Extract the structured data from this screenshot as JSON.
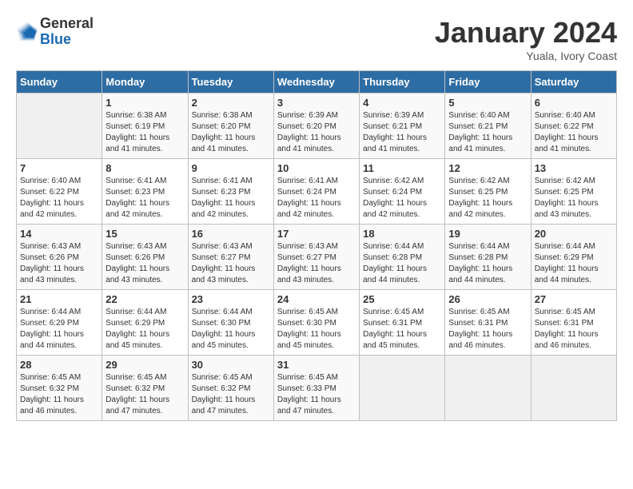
{
  "header": {
    "logo": {
      "general": "General",
      "blue": "Blue"
    },
    "title": "January 2024",
    "subtitle": "Yuala, Ivory Coast"
  },
  "weekdays": [
    "Sunday",
    "Monday",
    "Tuesday",
    "Wednesday",
    "Thursday",
    "Friday",
    "Saturday"
  ],
  "weeks": [
    [
      {
        "day": "",
        "sunrise": "",
        "sunset": "",
        "daylight": ""
      },
      {
        "day": "1",
        "sunrise": "Sunrise: 6:38 AM",
        "sunset": "Sunset: 6:19 PM",
        "daylight": "Daylight: 11 hours and 41 minutes."
      },
      {
        "day": "2",
        "sunrise": "Sunrise: 6:38 AM",
        "sunset": "Sunset: 6:20 PM",
        "daylight": "Daylight: 11 hours and 41 minutes."
      },
      {
        "day": "3",
        "sunrise": "Sunrise: 6:39 AM",
        "sunset": "Sunset: 6:20 PM",
        "daylight": "Daylight: 11 hours and 41 minutes."
      },
      {
        "day": "4",
        "sunrise": "Sunrise: 6:39 AM",
        "sunset": "Sunset: 6:21 PM",
        "daylight": "Daylight: 11 hours and 41 minutes."
      },
      {
        "day": "5",
        "sunrise": "Sunrise: 6:40 AM",
        "sunset": "Sunset: 6:21 PM",
        "daylight": "Daylight: 11 hours and 41 minutes."
      },
      {
        "day": "6",
        "sunrise": "Sunrise: 6:40 AM",
        "sunset": "Sunset: 6:22 PM",
        "daylight": "Daylight: 11 hours and 41 minutes."
      }
    ],
    [
      {
        "day": "7",
        "sunrise": "Sunrise: 6:40 AM",
        "sunset": "Sunset: 6:22 PM",
        "daylight": "Daylight: 11 hours and 42 minutes."
      },
      {
        "day": "8",
        "sunrise": "Sunrise: 6:41 AM",
        "sunset": "Sunset: 6:23 PM",
        "daylight": "Daylight: 11 hours and 42 minutes."
      },
      {
        "day": "9",
        "sunrise": "Sunrise: 6:41 AM",
        "sunset": "Sunset: 6:23 PM",
        "daylight": "Daylight: 11 hours and 42 minutes."
      },
      {
        "day": "10",
        "sunrise": "Sunrise: 6:41 AM",
        "sunset": "Sunset: 6:24 PM",
        "daylight": "Daylight: 11 hours and 42 minutes."
      },
      {
        "day": "11",
        "sunrise": "Sunrise: 6:42 AM",
        "sunset": "Sunset: 6:24 PM",
        "daylight": "Daylight: 11 hours and 42 minutes."
      },
      {
        "day": "12",
        "sunrise": "Sunrise: 6:42 AM",
        "sunset": "Sunset: 6:25 PM",
        "daylight": "Daylight: 11 hours and 42 minutes."
      },
      {
        "day": "13",
        "sunrise": "Sunrise: 6:42 AM",
        "sunset": "Sunset: 6:25 PM",
        "daylight": "Daylight: 11 hours and 43 minutes."
      }
    ],
    [
      {
        "day": "14",
        "sunrise": "Sunrise: 6:43 AM",
        "sunset": "Sunset: 6:26 PM",
        "daylight": "Daylight: 11 hours and 43 minutes."
      },
      {
        "day": "15",
        "sunrise": "Sunrise: 6:43 AM",
        "sunset": "Sunset: 6:26 PM",
        "daylight": "Daylight: 11 hours and 43 minutes."
      },
      {
        "day": "16",
        "sunrise": "Sunrise: 6:43 AM",
        "sunset": "Sunset: 6:27 PM",
        "daylight": "Daylight: 11 hours and 43 minutes."
      },
      {
        "day": "17",
        "sunrise": "Sunrise: 6:43 AM",
        "sunset": "Sunset: 6:27 PM",
        "daylight": "Daylight: 11 hours and 43 minutes."
      },
      {
        "day": "18",
        "sunrise": "Sunrise: 6:44 AM",
        "sunset": "Sunset: 6:28 PM",
        "daylight": "Daylight: 11 hours and 44 minutes."
      },
      {
        "day": "19",
        "sunrise": "Sunrise: 6:44 AM",
        "sunset": "Sunset: 6:28 PM",
        "daylight": "Daylight: 11 hours and 44 minutes."
      },
      {
        "day": "20",
        "sunrise": "Sunrise: 6:44 AM",
        "sunset": "Sunset: 6:29 PM",
        "daylight": "Daylight: 11 hours and 44 minutes."
      }
    ],
    [
      {
        "day": "21",
        "sunrise": "Sunrise: 6:44 AM",
        "sunset": "Sunset: 6:29 PM",
        "daylight": "Daylight: 11 hours and 44 minutes."
      },
      {
        "day": "22",
        "sunrise": "Sunrise: 6:44 AM",
        "sunset": "Sunset: 6:29 PM",
        "daylight": "Daylight: 11 hours and 45 minutes."
      },
      {
        "day": "23",
        "sunrise": "Sunrise: 6:44 AM",
        "sunset": "Sunset: 6:30 PM",
        "daylight": "Daylight: 11 hours and 45 minutes."
      },
      {
        "day": "24",
        "sunrise": "Sunrise: 6:45 AM",
        "sunset": "Sunset: 6:30 PM",
        "daylight": "Daylight: 11 hours and 45 minutes."
      },
      {
        "day": "25",
        "sunrise": "Sunrise: 6:45 AM",
        "sunset": "Sunset: 6:31 PM",
        "daylight": "Daylight: 11 hours and 45 minutes."
      },
      {
        "day": "26",
        "sunrise": "Sunrise: 6:45 AM",
        "sunset": "Sunset: 6:31 PM",
        "daylight": "Daylight: 11 hours and 46 minutes."
      },
      {
        "day": "27",
        "sunrise": "Sunrise: 6:45 AM",
        "sunset": "Sunset: 6:31 PM",
        "daylight": "Daylight: 11 hours and 46 minutes."
      }
    ],
    [
      {
        "day": "28",
        "sunrise": "Sunrise: 6:45 AM",
        "sunset": "Sunset: 6:32 PM",
        "daylight": "Daylight: 11 hours and 46 minutes."
      },
      {
        "day": "29",
        "sunrise": "Sunrise: 6:45 AM",
        "sunset": "Sunset: 6:32 PM",
        "daylight": "Daylight: 11 hours and 47 minutes."
      },
      {
        "day": "30",
        "sunrise": "Sunrise: 6:45 AM",
        "sunset": "Sunset: 6:32 PM",
        "daylight": "Daylight: 11 hours and 47 minutes."
      },
      {
        "day": "31",
        "sunrise": "Sunrise: 6:45 AM",
        "sunset": "Sunset: 6:33 PM",
        "daylight": "Daylight: 11 hours and 47 minutes."
      },
      {
        "day": "",
        "sunrise": "",
        "sunset": "",
        "daylight": ""
      },
      {
        "day": "",
        "sunrise": "",
        "sunset": "",
        "daylight": ""
      },
      {
        "day": "",
        "sunrise": "",
        "sunset": "",
        "daylight": ""
      }
    ]
  ]
}
